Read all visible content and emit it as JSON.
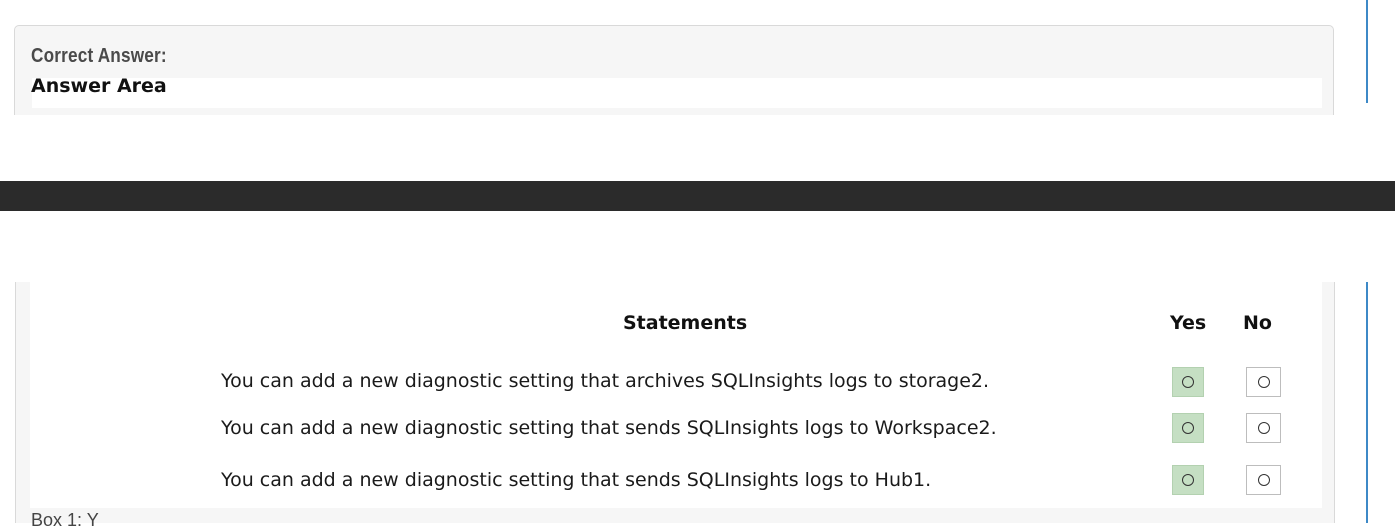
{
  "header": {
    "correct_answer_label": "Correct Answer:",
    "answer_area_title": "Answer Area"
  },
  "table": {
    "columns": {
      "statements": "Statements",
      "yes": "Yes",
      "no": "No"
    },
    "rows": [
      {
        "statement": "You can add a new diagnostic setting that archives SQLInsights logs to storage2.",
        "selected": "Yes"
      },
      {
        "statement": "You can add a new diagnostic setting that sends SQLInsights logs to Workspace2.",
        "selected": "Yes"
      },
      {
        "statement": "You can add a new diagnostic setting that sends SQLInsights logs to Hub1.",
        "selected": "Yes"
      }
    ]
  },
  "footer": {
    "cut_text": "Box 1: Y"
  },
  "colors": {
    "selected_green": "#c5dfc3",
    "accent_rule": "#3d89c7",
    "dark_band": "#2b2b2b"
  }
}
